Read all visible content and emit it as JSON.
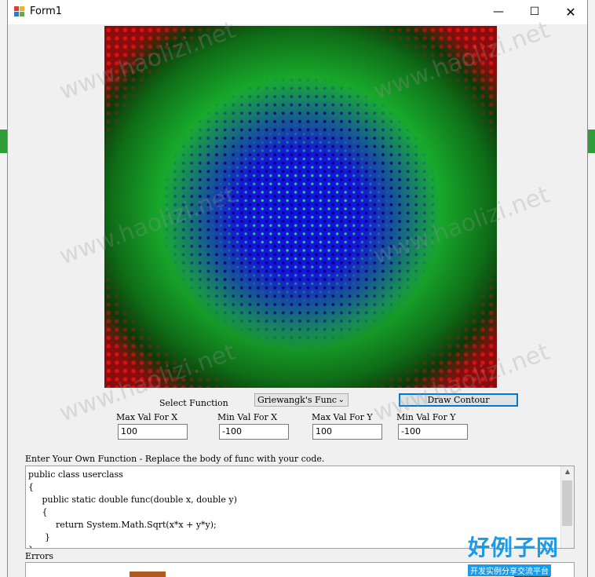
{
  "window": {
    "title": "Form1"
  },
  "controls": {
    "select_function_label": "Select Function",
    "function_selected": "Griewangk's Func",
    "draw_button": "Draw Contour",
    "max_x_label": "Max Val For X",
    "min_x_label": "Min Val For X",
    "max_y_label": "Max Val For Y",
    "min_y_label": "Min Val For Y",
    "max_x_value": "100",
    "min_x_value": "-100",
    "max_y_value": "100",
    "min_y_value": "-100"
  },
  "code": {
    "prompt": "Enter Your Own Function - Replace the body of func with your code.",
    "lines": [
      "public class userclass",
      "{",
      "     public static double func(double x, double y)",
      "     {",
      "          return System.Math.Sqrt(x*x + y*y);",
      "      }",
      "}"
    ]
  },
  "errors_label": "Errors",
  "watermark": {
    "text": "www.haolizi.net",
    "brand": "好例子网",
    "brand_sub": "开发实例分享交流平台"
  },
  "colors": {
    "accent": "#0078d7",
    "plot_low": "#1414d8",
    "plot_mid": "#19c030",
    "plot_high": "#c01010"
  }
}
